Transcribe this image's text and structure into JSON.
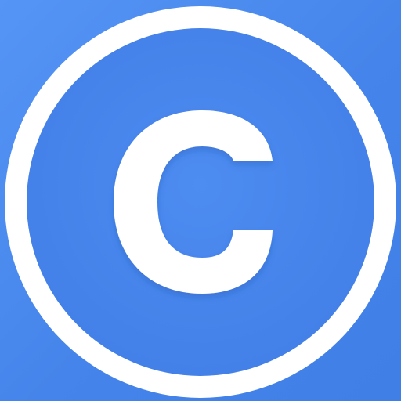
{
  "app_icon": {
    "icon_name": "copyright-icon",
    "colors": {
      "background": "#4d8df0",
      "inner_circle": "#4a88ed",
      "ring": "#ffffff",
      "letter": "#ffffff"
    }
  }
}
